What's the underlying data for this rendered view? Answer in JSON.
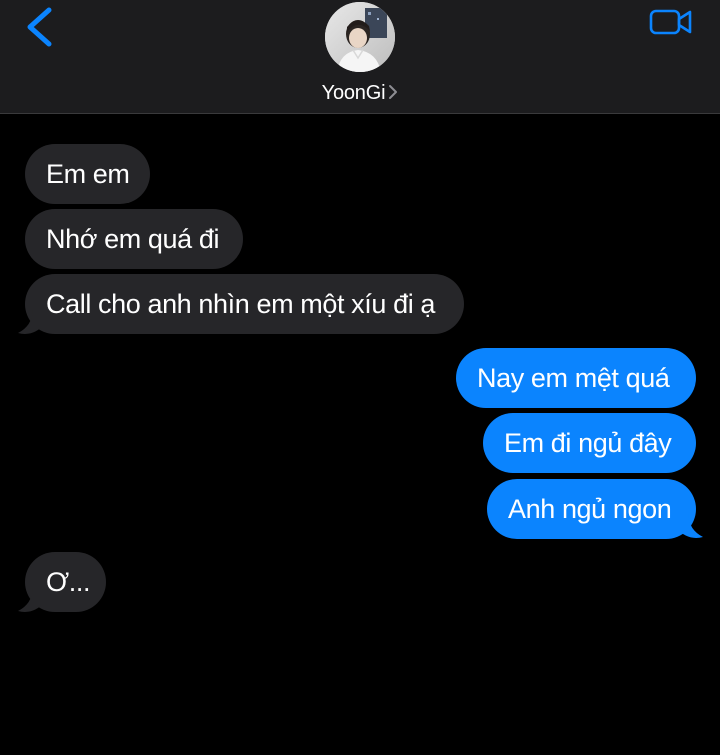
{
  "header": {
    "contact_name": "YoonGi",
    "back_icon": "chevron-left-icon",
    "video_icon": "video-camera-icon",
    "accent": "#0b84fe"
  },
  "messages": {
    "incoming_1": "Em em",
    "incoming_2": "Nhớ em quá đi",
    "incoming_3": "Call cho anh nhìn em một xíu đi ạ",
    "outgoing_1": "Nay em mệt quá",
    "outgoing_2": "Em đi ngủ đây",
    "outgoing_3": "Anh ngủ ngon",
    "incoming_4": "Ơ..."
  },
  "colors": {
    "incoming_bubble": "#262629",
    "outgoing_bubble": "#0b84fe",
    "background": "#000000",
    "header_bg": "#1c1c1e"
  }
}
